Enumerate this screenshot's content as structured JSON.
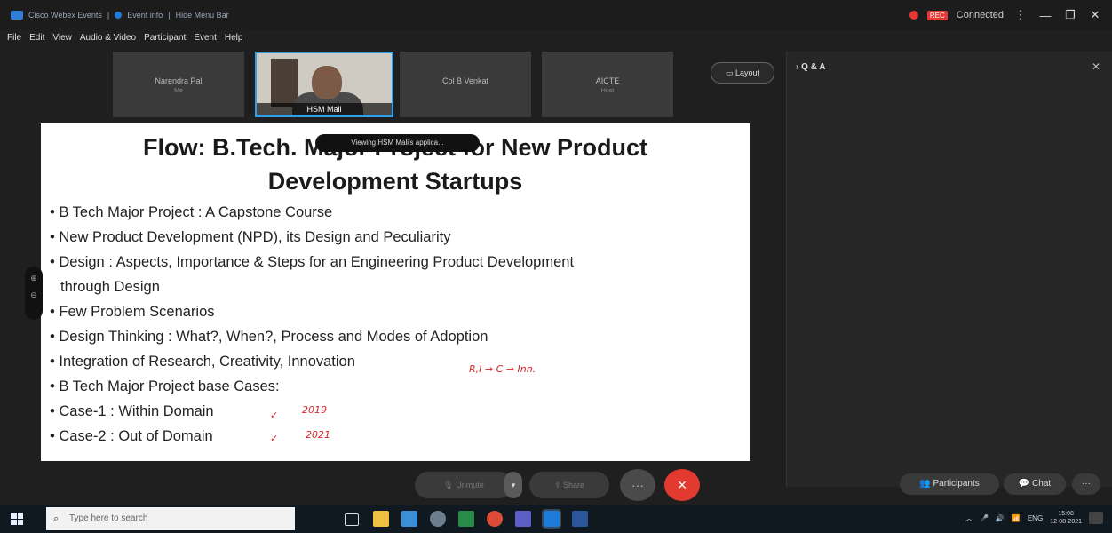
{
  "titlebar": {
    "app_name": "Cisco Webex Events",
    "event_info": "Event info",
    "hide_menu": "Hide Menu Bar",
    "connected": "Connected",
    "rec_badge": "REC"
  },
  "menu": [
    "File",
    "Edit",
    "View",
    "Audio & Video",
    "Participant",
    "Event",
    "Help"
  ],
  "participants": [
    {
      "name": "Narendra Pal",
      "sub": "Me"
    },
    {
      "name": "HSM Mali",
      "sub": ""
    },
    {
      "name": "Col B Venkat",
      "sub": ""
    },
    {
      "name": "AICTE",
      "sub": "Host"
    }
  ],
  "layout_label": "Layout",
  "qa": {
    "title": "Q & A"
  },
  "toast": "Viewing HSM Mali's applica...",
  "slide": {
    "title_line1": "Flow: B.Tech. Major Project for New Product",
    "title_line2": "Development Startups",
    "bullets": [
      "B Tech Major Project : A Capstone Course",
      "New Product Development (NPD), its Design and Peculiarity",
      "Design : Aspects, Importance & Steps for an Engineering Product Development",
      "through Design",
      "Few Problem Scenarios",
      "Design Thinking : What?, When?, Process and Modes of Adoption",
      "Integration of Research, Creativity, Innovation",
      "B Tech Major Project base Cases:",
      "Case-1 : Within Domain",
      "Case-2 : Out of Domain"
    ],
    "annotations": {
      "integration_note": "R,I → C → Inn.",
      "case1_year": "2019",
      "case2_year": "2021"
    }
  },
  "controls": {
    "unmute": "Unmute",
    "share": "Share",
    "end_icon": "×",
    "more_icon": "···",
    "participants": "Participants",
    "chat": "Chat",
    "overflow": "···"
  },
  "taskbar": {
    "search_placeholder": "Type here to search",
    "lang": "ENG",
    "time": "15:08",
    "date": "12-08-2021"
  },
  "colors": {
    "accent": "#2fa0e8",
    "end_call": "#e23a2f",
    "annotation": "#d8232a"
  }
}
